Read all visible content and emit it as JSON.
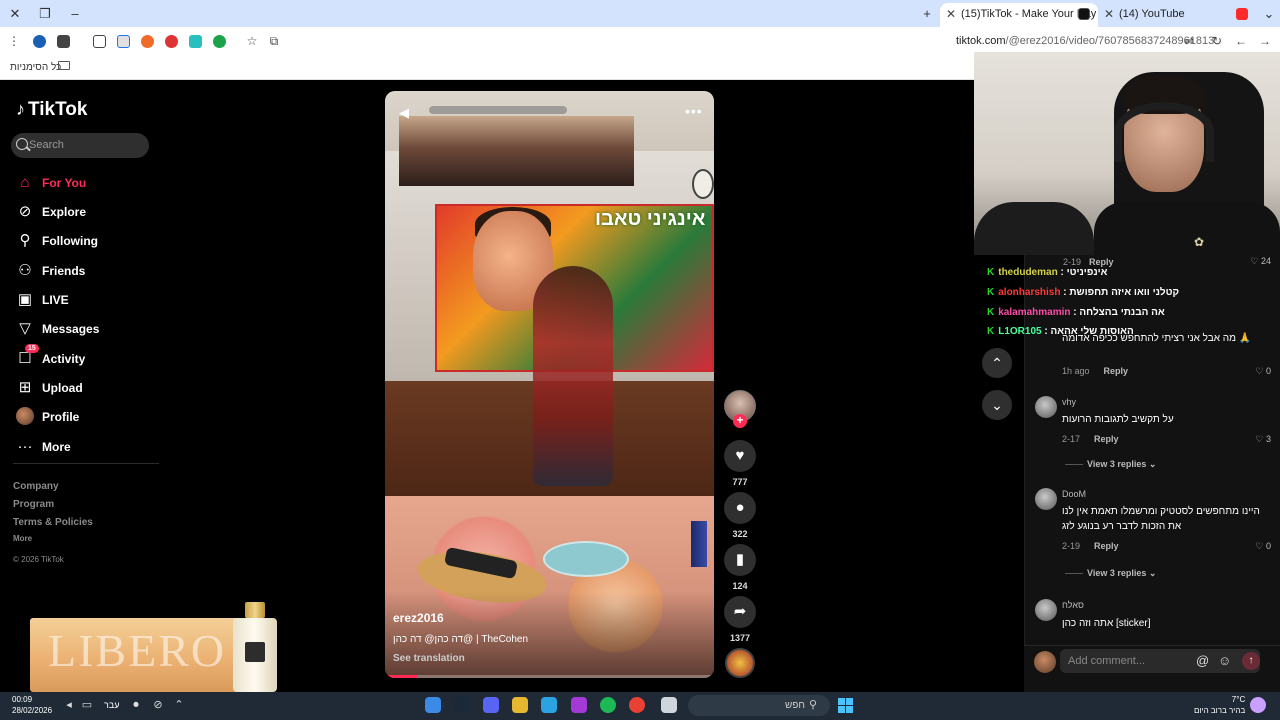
{
  "browser": {
    "tabs": [
      {
        "title": "(15)TikTok - Make Your Day",
        "active": true
      },
      {
        "title": "(14) YouTube",
        "active": false
      }
    ],
    "url_host": "tiktok.com",
    "url_path": "/@erez2016/video/7607856837248961813",
    "bookmarks_label": "כל הסימניות"
  },
  "sidebar": {
    "logo": "TikTok",
    "search_placeholder": "Search",
    "nav": [
      {
        "label": "For You",
        "icon": "home-icon",
        "active": true
      },
      {
        "label": "Explore",
        "icon": "compass-icon"
      },
      {
        "label": "Following",
        "icon": "following-icon"
      },
      {
        "label": "Friends",
        "icon": "friends-icon"
      },
      {
        "label": "LIVE",
        "icon": "live-icon"
      },
      {
        "label": "Messages",
        "icon": "messages-icon"
      },
      {
        "label": "Activity",
        "icon": "activity-icon",
        "badge": "15"
      },
      {
        "label": "Upload",
        "icon": "upload-icon"
      },
      {
        "label": "Profile",
        "icon": "profile-avatar"
      },
      {
        "label": "More",
        "icon": "more-icon"
      }
    ],
    "footer": {
      "company": "Company",
      "program": "Program",
      "terms": "Terms & Policies",
      "more": "More",
      "copyright": "© 2026 TikTok"
    }
  },
  "ad": {
    "brand_text": "LIBERO"
  },
  "video": {
    "author": "erez2016",
    "caption": "דה כהן@ דה כהן@ | TheCohen",
    "see_translation": "See translation",
    "poster_text": "אינגיני טאבו",
    "progress": 0.1
  },
  "actions": {
    "likes": "777",
    "comments": "322",
    "saves": "124",
    "shares": "1377"
  },
  "chat": [
    {
      "user": "thedudeman",
      "text": ": אינפיניטי",
      "color": "yellow"
    },
    {
      "user": "alonharshish",
      "text": ": קטלני וואו איזה תחפושת",
      "color": "red"
    },
    {
      "user": "kalamahmamin",
      "text": ": אה הבנתי בהצלחה",
      "color": "pink"
    },
    {
      "user": "L1OR105",
      "text": ": האוסות שלי אהאה",
      "color": "green"
    }
  ],
  "comments": {
    "top_time": "2-19",
    "top_reply": "Reply",
    "top_likes": "24",
    "items": [
      {
        "user": "",
        "text": "מה אבל אני רציתי להתחפש ככיפה אדומה 🙏",
        "time": "1h ago",
        "reply": "Reply",
        "likes": "0"
      },
      {
        "user": "vhy",
        "text": "על תקשיב לתגובות הרועות",
        "time": "2-17",
        "reply": "Reply",
        "likes": "3",
        "view_replies": "View 3 replies"
      },
      {
        "user": "DooM",
        "text": "היינו מתחפשים לסטטיק ומרשמלו תאמת אין לנו את הזכות לדבר רע בנוגע לזג",
        "time": "2-19",
        "reply": "Reply",
        "likes": "0",
        "view_replies": "View 3 replies"
      },
      {
        "user": "סאלח",
        "text": "אתה וזה כהן [sticker]"
      }
    ],
    "add_placeholder": "Add comment..."
  },
  "taskbar": {
    "time": "00:09",
    "date": "28/02/2026",
    "lang": "עבר",
    "search_text": "חפש",
    "weather_temp": "7°C",
    "weather_text": "בהיר ברוב היום"
  }
}
